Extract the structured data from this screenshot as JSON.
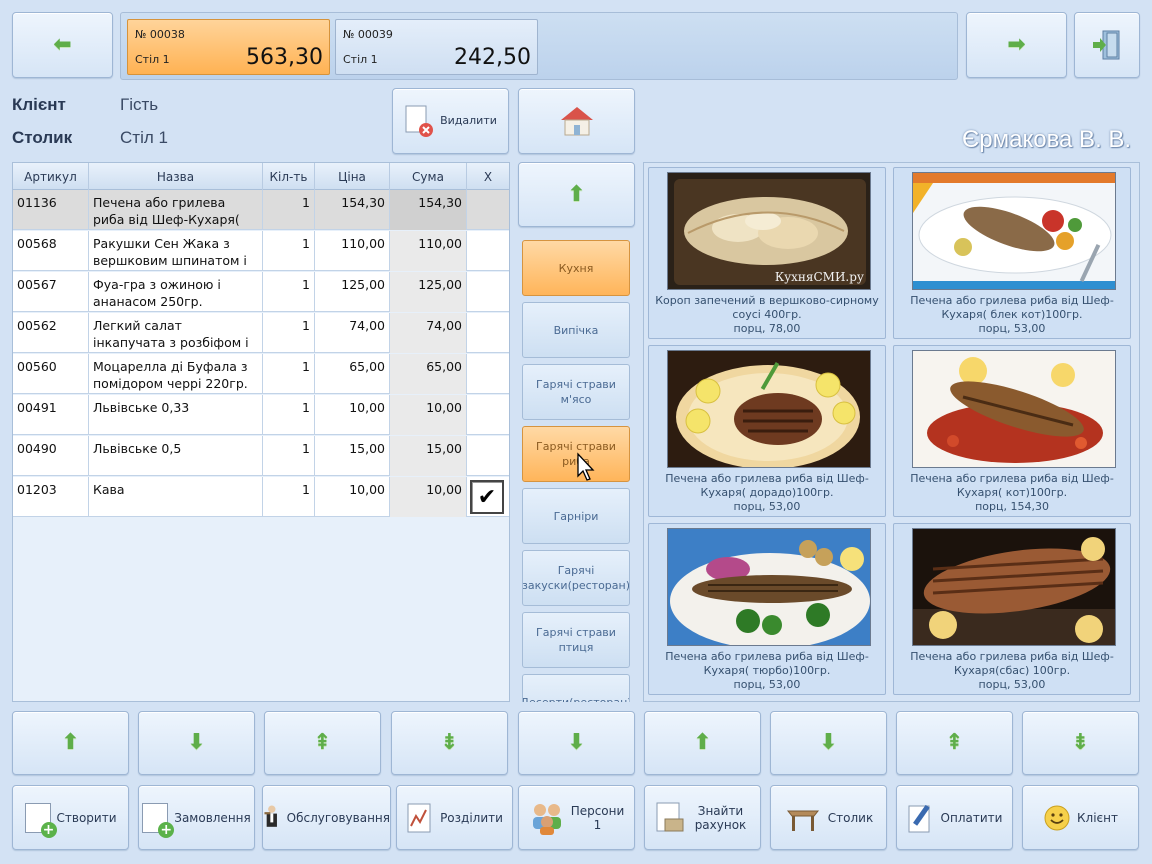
{
  "nav": {
    "back_arrow": "⬅",
    "forward_arrow": "➡"
  },
  "orders": [
    {
      "number": "№ 00038",
      "table": "Стіл 1",
      "amount": "563,30",
      "active": true
    },
    {
      "number": "№ 00039",
      "table": "Стіл 1",
      "amount": "242,50",
      "active": false
    }
  ],
  "info": {
    "client_label": "Клієнт",
    "client_value": "Гість",
    "table_label": "Столик",
    "table_value": "Стіл 1"
  },
  "delete_button": {
    "label": "Видалити"
  },
  "user_name": "Єрмакова В. В.",
  "table": {
    "headers": [
      "Артикул",
      "Назва",
      "Кіл-ть",
      "Ціна",
      "Сума",
      "X"
    ],
    "rows": [
      {
        "code": "01136",
        "name": "Печена або грилева риба від Шеф-Кухаря(",
        "qty": "1",
        "price": "154,30",
        "sum": "154,30"
      },
      {
        "code": "00568",
        "name": "Ракушки Сен Жака з вершковим шпинатом і",
        "qty": "1",
        "price": "110,00",
        "sum": "110,00"
      },
      {
        "code": "00567",
        "name": "Фуа-гра з ожиною і ананасом 250гр.",
        "qty": "1",
        "price": "125,00",
        "sum": "125,00"
      },
      {
        "code": "00562",
        "name": "Легкий салат інкапучата з розбіфом і пінією",
        "qty": "1",
        "price": "74,00",
        "sum": "74,00"
      },
      {
        "code": "00560",
        "name": "Моцарелла ді Буфала з помідором черрі 220гр.",
        "qty": "1",
        "price": "65,00",
        "sum": "65,00"
      },
      {
        "code": "00491",
        "name": "Львівське 0,33",
        "qty": "1",
        "price": "10,00",
        "sum": "10,00"
      },
      {
        "code": "00490",
        "name": "Львівське 0,5",
        "qty": "1",
        "price": "15,00",
        "sum": "15,00"
      },
      {
        "code": "01203",
        "name": "Кава",
        "qty": "1",
        "price": "10,00",
        "sum": "10,00",
        "checked_mark": "✔"
      }
    ]
  },
  "categories": [
    {
      "label": "Кухня",
      "active": true
    },
    {
      "label": "Випічка",
      "active": false
    },
    {
      "label": "Гарячі страви м'ясо",
      "active": false
    },
    {
      "label": "Гарячі страви риба",
      "active": true
    },
    {
      "label": "Гарніри",
      "active": false
    },
    {
      "label": "Гарячі закуски(ресторан)",
      "active": false
    },
    {
      "label": "Гарячі страви птиця",
      "active": false
    },
    {
      "label": "Десерти(ресторан)",
      "active": false
    }
  ],
  "products": [
    {
      "name": "Короп запечений в вершково-сирному соусі 400гр.",
      "price": "порц, 78,00",
      "watermark": "КухняСМИ.ру"
    },
    {
      "name": "Печена або грилева риба від Шеф-Кухаря( блек кот)100гр.",
      "price": "порц, 53,00"
    },
    {
      "name": "Печена або грилева риба від Шеф-Кухаря( дорадо)100гр.",
      "price": "порц, 53,00"
    },
    {
      "name": "Печена або грилева риба від Шеф-Кухаря( кот)100гр.",
      "price": "порц, 154,30"
    },
    {
      "name": "Печена або грилева риба від Шеф-Кухаря( тюрбо)100гр.",
      "price": "порц, 53,00"
    },
    {
      "name": "Печена або грилева риба від Шеф-Кухаря(сбас) 100гр.",
      "price": "порц, 53,00"
    }
  ],
  "scroll_arrows": [
    "⬆",
    "⬇",
    "⇞",
    "⇟",
    "⬇",
    "⬆",
    "⬇",
    "⇞",
    "⇟"
  ],
  "toolbar": {
    "create": "Створити",
    "order": "Замовлення",
    "service": "Обслуговування",
    "split": "Розділити",
    "persons": "Персони",
    "persons_count": "1",
    "find_bill": "Знайти рахунок",
    "table": "Столик",
    "pay": "Оплатити",
    "client": "Клієнт"
  }
}
